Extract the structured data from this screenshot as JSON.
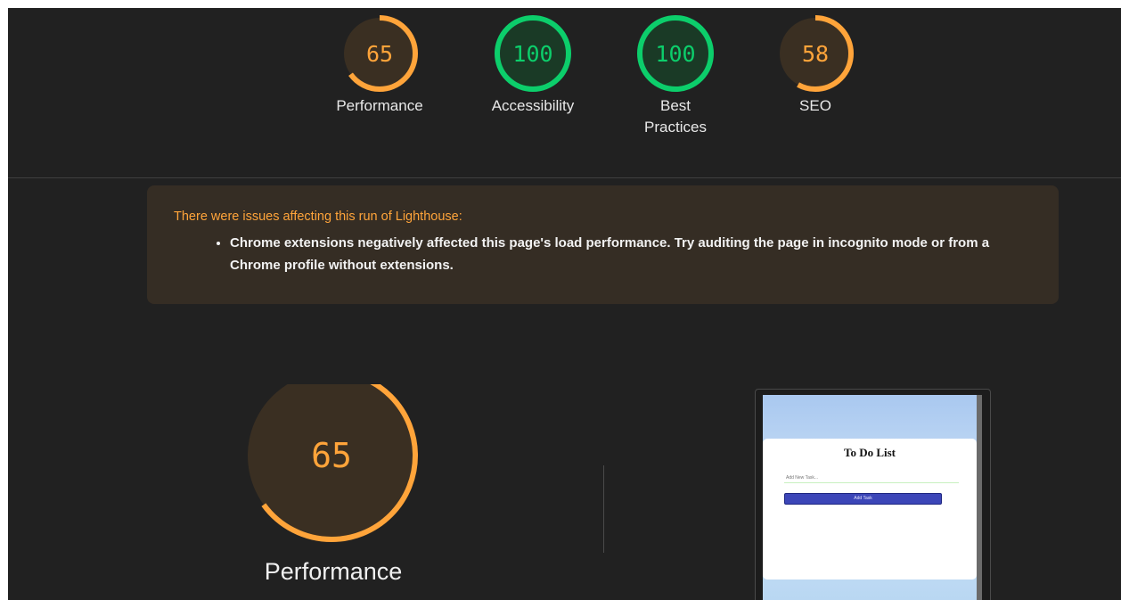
{
  "scores": [
    {
      "value": "65",
      "label": "Performance",
      "score": 0.65,
      "color": "#ffa43a"
    },
    {
      "value": "100",
      "label": "Accessibility",
      "score": 1.0,
      "color": "#0cce6b"
    },
    {
      "value": "100",
      "label": "Best Practices",
      "score": 1.0,
      "color": "#0cce6b"
    },
    {
      "value": "58",
      "label": "SEO",
      "score": 0.58,
      "color": "#ffa43a"
    }
  ],
  "warning": {
    "title": "There were issues affecting this run of Lighthouse:",
    "items": [
      "Chrome extensions negatively affected this page's load performance. Try auditing the page in incognito mode or from a Chrome profile without extensions."
    ]
  },
  "main_gauge": {
    "value": "65",
    "score": 0.65,
    "label": "Performance",
    "color": "#ffa43a"
  },
  "preview": {
    "title": "To Do List",
    "input_placeholder": "Add New Task...",
    "button_label": "Add Task"
  },
  "colors": {
    "background": "#212121",
    "average": "#ffa43a",
    "pass": "#0cce6b",
    "warning_bg": "#352d24"
  }
}
